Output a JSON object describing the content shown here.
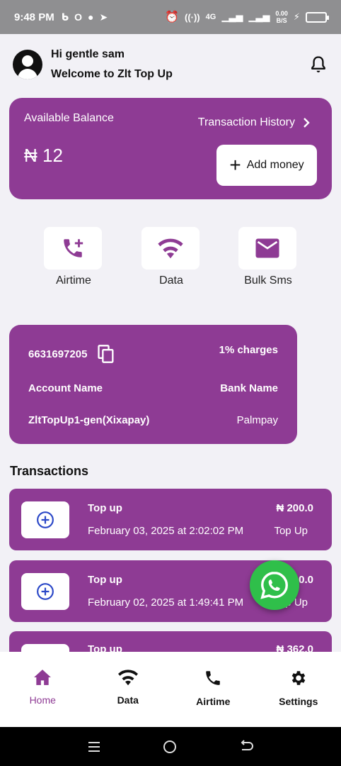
{
  "status_bar": {
    "time": "9:48 PM",
    "left_icons": [
      "b-icon",
      "o-icon",
      "chat-icon",
      "telegram-icon"
    ],
    "network_label": "4G",
    "speed_value": "0.00",
    "speed_unit": "B/S"
  },
  "header": {
    "greeting": "Hi gentle sam",
    "welcome": "Welcome to Zlt Top Up"
  },
  "balance": {
    "label": "Available Balance",
    "value": "₦ 12",
    "history_label": "Transaction History",
    "add_money_label": "Add money"
  },
  "services": [
    {
      "label": "Airtime",
      "icon": "phone-plus-icon"
    },
    {
      "label": "Data",
      "icon": "wifi-icon"
    },
    {
      "label": "Bulk Sms",
      "icon": "mail-icon"
    }
  ],
  "account": {
    "number": "6631697205",
    "charges": "1% charges",
    "account_name_label": "Account Name",
    "bank_name_label": "Bank Name",
    "account_name_value": "ZltTopUp1-gen(Xixapay)",
    "bank_name_value": "Palmpay"
  },
  "transactions_title": "Transactions",
  "transactions": [
    {
      "title": "Top up",
      "date": "February 03, 2025 at 2:02:02 PM",
      "amount": "₦ 200.0",
      "kind": "Top Up"
    },
    {
      "title": "Top up",
      "date": "February 02, 2025 at 1:49:41 PM",
      "amount": "₦ 200.0",
      "kind": "Top Up"
    },
    {
      "title": "Top up",
      "date": "",
      "amount": "₦ 362.0",
      "kind": ""
    }
  ],
  "bottom_nav": [
    {
      "label": "Home",
      "icon": "home-icon",
      "active": true
    },
    {
      "label": "Data",
      "icon": "wifi-icon",
      "active": false
    },
    {
      "label": "Airtime",
      "icon": "phone-icon",
      "active": false
    },
    {
      "label": "Settings",
      "icon": "gear-icon",
      "active": false
    }
  ],
  "colors": {
    "primary": "#8e3b94",
    "background": "#f2f1f6",
    "whatsapp": "#2fbf4a",
    "accent_blue": "#2a47c7"
  }
}
